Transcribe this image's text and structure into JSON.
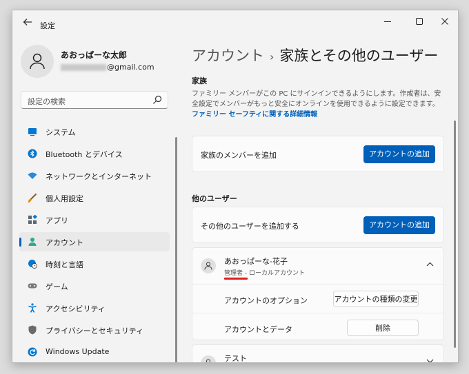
{
  "window": {
    "app_title": "設定",
    "back_icon": "back-arrow-icon",
    "controls": [
      "minimize-icon",
      "maximize-icon",
      "close-icon"
    ]
  },
  "user": {
    "name": "あおっぱーな太郎",
    "email_suffix": "@gmail.com",
    "avatar_icon": "person-icon"
  },
  "search": {
    "placeholder": "設定の検索",
    "icon": "search-icon"
  },
  "nav": [
    {
      "label": "システム",
      "icon": "system-icon",
      "color": "#0078d4"
    },
    {
      "label": "Bluetooth とデバイス",
      "icon": "bluetooth-icon",
      "color": "#0078d4"
    },
    {
      "label": "ネットワークとインターネット",
      "icon": "wifi-icon",
      "color": "#2b88d8"
    },
    {
      "label": "個人用設定",
      "icon": "brush-icon",
      "color": "#e08a00"
    },
    {
      "label": "アプリ",
      "icon": "apps-icon",
      "color": "#5c6670"
    },
    {
      "label": "アカウント",
      "icon": "account-icon",
      "color": "#2fa88c",
      "active": true
    },
    {
      "label": "時刻と言語",
      "icon": "globe-clock-icon",
      "color": "#0078d4"
    },
    {
      "label": "ゲーム",
      "icon": "gamepad-icon",
      "color": "#7a7a7a"
    },
    {
      "label": "アクセシビリティ",
      "icon": "accessibility-icon",
      "color": "#0078d4"
    },
    {
      "label": "プライバシーとセキュリティ",
      "icon": "shield-icon",
      "color": "#6a6a6a"
    },
    {
      "label": "Windows Update",
      "icon": "update-icon",
      "color": "#0078d4"
    }
  ],
  "main": {
    "breadcrumb_parent": "アカウント",
    "breadcrumb_sep": "›",
    "breadcrumb_current": "家族とその他のユーザー",
    "family_heading": "家族",
    "family_desc": "ファミリー メンバーがこの PC にサインインできるようにします。作成者は、安全設定でメンバーがもっと安全にオンラインを使用できるように設定できます。",
    "family_link": "ファミリー セーフティに関する詳細情報",
    "family_add_label": "家族のメンバーを追加",
    "family_add_button": "アカウントの追加",
    "others_heading": "他のユーザー",
    "others_add_label": "その他のユーザーを追加する",
    "others_add_button": "アカウントの追加",
    "users": [
      {
        "name": "あおっぱーな-花子",
        "role": "管理者",
        "type": "ローカルアカウント",
        "expanded": true,
        "options_label": "アカウントのオプション",
        "options_button": "アカウントの種類の変更",
        "data_label": "アカウントとデータ",
        "data_button": "削除"
      },
      {
        "name": "テスト",
        "expanded": false
      }
    ]
  },
  "colors": {
    "accent": "#005fb8",
    "highlight_underline": "#e01b1b"
  }
}
